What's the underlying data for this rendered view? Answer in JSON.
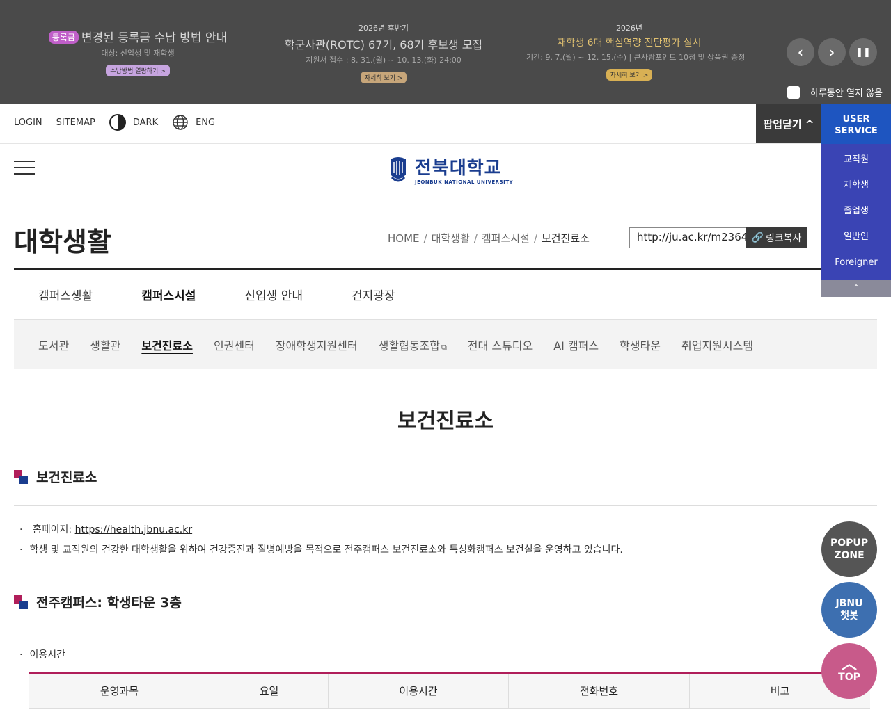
{
  "popup_banner": {
    "item1": {
      "tag": "등록금",
      "title": "변경된 등록금 수납 방법 안내",
      "desc": "대상: 신입생 및 재학생",
      "button": "수납방법 열람하기 >"
    },
    "item2": {
      "sup": "2026년 후반기",
      "title": "학군사관(ROTC) 67기, 68기 후보생 모집",
      "desc": "지원서 접수 : 8. 31.(월) ~ 10. 13.(화) 24:00",
      "button": "자세히 보기 >"
    },
    "item3": {
      "sup": "2026년",
      "title": "재학생 6대 핵심역량 진단평가 실시",
      "desc": "기간: 9. 7.(월) ~ 12. 15.(수) | 큰사람포인트 10점 및 상품권 증정",
      "button": "자세히 보기 >"
    },
    "controls": {
      "prev": "‹",
      "next": "›",
      "pause": "❚❚"
    },
    "no_show_today": "하루동안 열지 않음"
  },
  "utility": {
    "login": "LOGIN",
    "sitemap": "SITEMAP",
    "dark": "DARK",
    "eng": "ENG",
    "popup_close": "팝업닫기 ^"
  },
  "user_service": {
    "title_line1": "USER",
    "title_line2": "SERVICE",
    "items": [
      "교직원",
      "재학생",
      "졸업생",
      "일반인",
      "Foreigner"
    ],
    "toggle": "⌃"
  },
  "logo": {
    "ko": "전북대학교",
    "en": "JEONBUK NATIONAL UNIVERSITY"
  },
  "page": {
    "title": "대학생활",
    "breadcrumb": [
      "HOME",
      "대학생활",
      "캠퍼스시설",
      "보건진료소"
    ],
    "url": "http://ju.ac.kr/m2364",
    "copy_button": "링크복사"
  },
  "menu1": [
    "캠퍼스생활",
    "캠퍼스시설",
    "신입생 안내",
    "건지광장"
  ],
  "menu2": [
    "도서관",
    "생활관",
    "보건진료소",
    "인권센터",
    "장애학생지원센터",
    "생활협동조합",
    "전대 스튜디오",
    "AI 캠퍼스",
    "학생타운",
    "취업지원시스템"
  ],
  "content": {
    "title": "보건진료소",
    "section1": {
      "heading": "보건진료소",
      "homepage_label": "홈페이지: ",
      "homepage_url": "https://health.jbnu.ac.kr",
      "desc": "학생 및 교직원의 건강한 대학생활을 위하여 건강증진과 질병예방을 목적으로 전주캠퍼스 보건진료소와 특성화캠퍼스 보건실을 운영하고 있습니다."
    },
    "section2": {
      "heading": "전주캠퍼스: 학생타운 3층",
      "bullet": "이용시간",
      "table_headers": [
        "운영과목",
        "요일",
        "이용시간",
        "전화번호",
        "비고"
      ]
    }
  },
  "floating": {
    "popup_zone_1": "POPUP",
    "popup_zone_2": "ZONE",
    "chatbot_1": "JBNU",
    "chatbot_2": "챗봇",
    "top": "TOP"
  }
}
